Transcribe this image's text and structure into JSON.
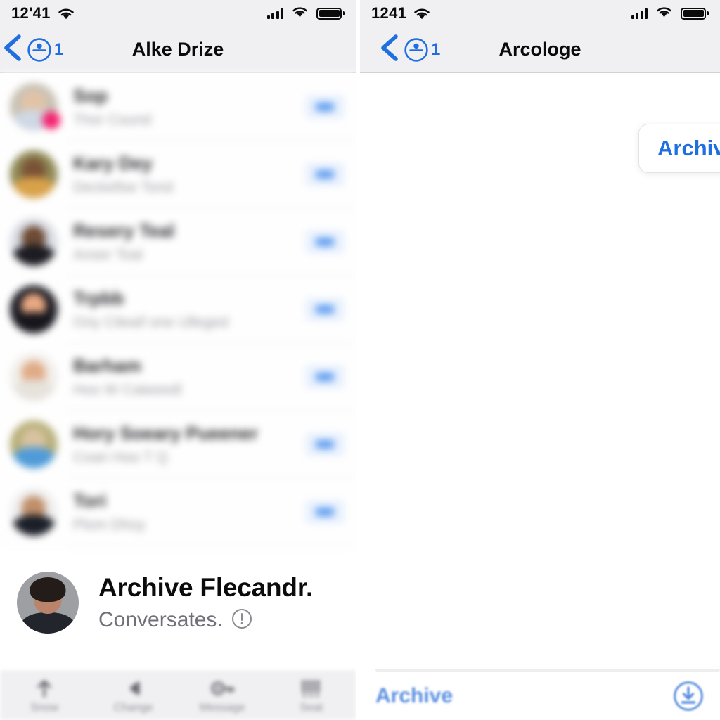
{
  "left": {
    "status_bar": {
      "time": "12'41",
      "wifi_icon": "wifi-icon",
      "signal_icon": "cellular-signal-icon",
      "battery_icon": "battery-icon"
    },
    "nav": {
      "back_icon": "back-chevron-icon",
      "person_icon": "person-circle-icon",
      "badge_count": "1",
      "title": "Alke Drize"
    },
    "conversations": [
      {
        "name": "Sop",
        "preview": "Thor  Cound",
        "unread_badge": "badge-pill",
        "has_dot": true,
        "avatar": {
          "hair": "#4d6042",
          "face": "#e2c3a6",
          "shirt": "#cfd8e4",
          "bg": "#c9c2b5"
        }
      },
      {
        "name": "Kary Dey",
        "preview": "Deckellse  Tond",
        "unread_badge": "badge-pill",
        "has_dot": false,
        "avatar": {
          "hair": "#4a5a2a",
          "face": "#7a5236",
          "shirt": "#d8a24a",
          "bg": "#8f8a57"
        }
      },
      {
        "name": "Resery Teal",
        "preview": "Anser Toal",
        "unread_badge": "badge-pill",
        "has_dot": false,
        "avatar": {
          "hair": "#241a15",
          "face": "#6d4a34",
          "shirt": "#1c1c22",
          "bg": "#d9dce4"
        }
      },
      {
        "name": "Trpbb",
        "preview": "Ony  Cileaif  one  Ulleged",
        "unread_badge": "badge-pill",
        "has_dot": false,
        "avatar": {
          "hair": "#1a1a22",
          "face": "#e8a882",
          "shirt": "#16161c",
          "bg": "#1d1d25"
        }
      },
      {
        "name": "Barham",
        "preview": "Hoo  W  Cateeedl",
        "unread_badge": "badge-pill",
        "has_dot": false,
        "avatar": {
          "hair": "#3a3028",
          "face": "#e0ab86",
          "shirt": "#e6e2dc",
          "bg": "#f1eeea"
        }
      },
      {
        "name": "Hory Soeary Pueener",
        "preview": "Coan  Hoo  T  Q",
        "unread_badge": "badge-pill",
        "has_dot": false,
        "avatar": {
          "hair": "#6f6a3e",
          "face": "#d8c2a0",
          "shirt": "#4f9bd8",
          "bg": "#b8b07a"
        }
      },
      {
        "name": "Tori",
        "preview": "Plom  Dhoy",
        "unread_badge": "badge-pill",
        "has_dot": false,
        "avatar": {
          "hair": "#2a1d16",
          "face": "#c08f6a",
          "shirt": "#1b1f28",
          "bg": "#efefef"
        }
      }
    ],
    "feature": {
      "title": "Archive Flecandr.",
      "subtitle": "Conversates.",
      "info_icon": "info-circle-icon",
      "avatar": "person-photo-avatar"
    },
    "tabbar": [
      {
        "icon": "arrow-up-icon",
        "label": "Snow"
      },
      {
        "icon": "play-back-icon",
        "label": "Change"
      },
      {
        "icon": "key-icon",
        "label": "Message"
      },
      {
        "icon": "keypad-grid-icon",
        "label": "Seat"
      }
    ]
  },
  "right": {
    "status_bar": {
      "time": "1241",
      "wifi_icon": "wifi-icon",
      "signal_icon": "cellular-signal-icon",
      "battery_icon": "battery-icon"
    },
    "nav": {
      "back_icon": "back-chevron-icon",
      "person_icon": "person-circle-icon",
      "badge_count": "1",
      "title": "Arcologe"
    },
    "archive_card": {
      "label": "Archive"
    },
    "bottom": {
      "label": "Archive",
      "download_icon": "download-circle-icon"
    }
  },
  "colors": {
    "accent_blue": "#1f6fe0",
    "badge_pink": "#f4246f",
    "chrome_gray": "#f0f0f2"
  }
}
